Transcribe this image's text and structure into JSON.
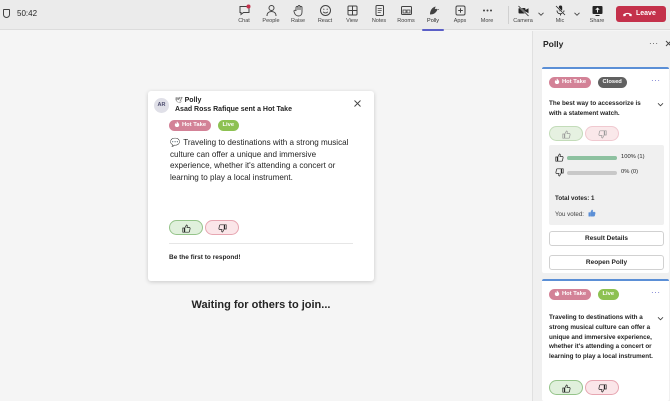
{
  "meeting": {
    "timer": "50:42"
  },
  "toolbar": {
    "chat": "Chat",
    "people": "People",
    "raise": "Raise",
    "react": "React",
    "view": "View",
    "notes": "Notes",
    "rooms": "Rooms",
    "polly": "Polly",
    "apps": "Apps",
    "more": "More",
    "camera": "Camera",
    "mic": "Mic",
    "share": "Share",
    "leave": "Leave"
  },
  "colors": {
    "accent": "#5b5fc7",
    "leave": "#c4314b",
    "hot_take": "#d38297",
    "live": "#8dc152",
    "closed": "#616161"
  },
  "notification": {
    "avatar_initials": "AR",
    "app_name": "Polly",
    "sender_line": "Asad Ross Rafique sent a Hot Take",
    "tag_type": "Hot Take",
    "tag_status": "Live",
    "question": "Traveling to destinations with a strong musical culture can offer a unique and immersive experience, whether it's attending a concert or learning to play a local instrument.",
    "empty_state": "Be the first to respond!"
  },
  "stage": {
    "waiting_text": "Waiting for others to join..."
  },
  "panel": {
    "title": "Polly",
    "polls": [
      {
        "tag_type": "Hot Take",
        "tag_status": "Closed",
        "question": "The best way to accessorize is with a statement watch.",
        "results": {
          "agree": {
            "percent": 100,
            "count": 1,
            "label": "100% (1)"
          },
          "disagree": {
            "percent": 0,
            "count": 0,
            "label": "0% (0)"
          },
          "total_votes": "Total votes: 1",
          "you_voted": "You voted:"
        },
        "result_details": "Result Details",
        "reopen": "Reopen Polly"
      },
      {
        "tag_type": "Hot Take",
        "tag_status": "Live",
        "question": "Traveling to destinations with a strong musical culture can offer a unique and immersive experience, whether it's attending a concert or learning to play a local instrument."
      }
    ]
  }
}
